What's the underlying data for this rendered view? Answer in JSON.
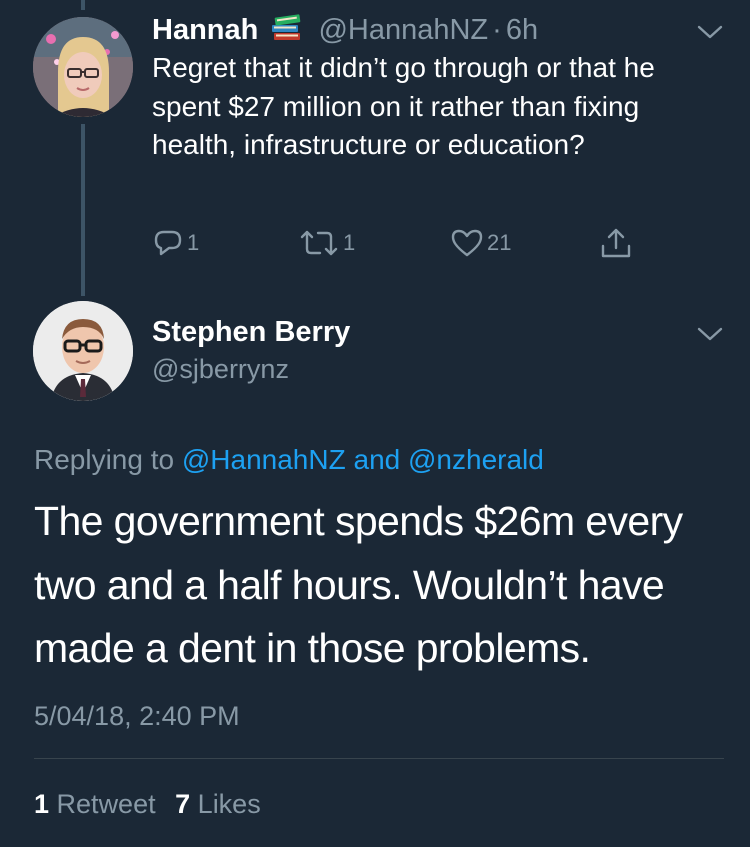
{
  "colors": {
    "background": "#1b2836",
    "muted": "#8899a6",
    "link": "#1da1f2",
    "text": "#ffffff",
    "thread_line": "#3d5466"
  },
  "reply_tweet": {
    "name": "Hannah",
    "name_emoji_icon": "books-emoji-icon",
    "handle": "@HannahNZ",
    "separator": "·",
    "time": "6h",
    "text": "Regret that it didn’t go through or that he spent $27 million on it rather than fixing health, infrastructure or education?",
    "actions": {
      "reply_count": "1",
      "retweet_count": "1",
      "like_count": "21"
    }
  },
  "main_tweet": {
    "name": "Stephen Berry",
    "handle": "@sjberrynz",
    "replying_prefix": "Replying to",
    "replying_to_1": "@HannahNZ",
    "replying_and": "and",
    "replying_to_2": "@nzherald",
    "text": "The government spends $26m every two and a half hours. Wouldn’t have made a dent in those problems.",
    "timestamp": "5/04/18, 2:40 PM",
    "retweets_count": "1",
    "retweets_label": "Retweet",
    "likes_count": "7",
    "likes_label": "Likes"
  }
}
